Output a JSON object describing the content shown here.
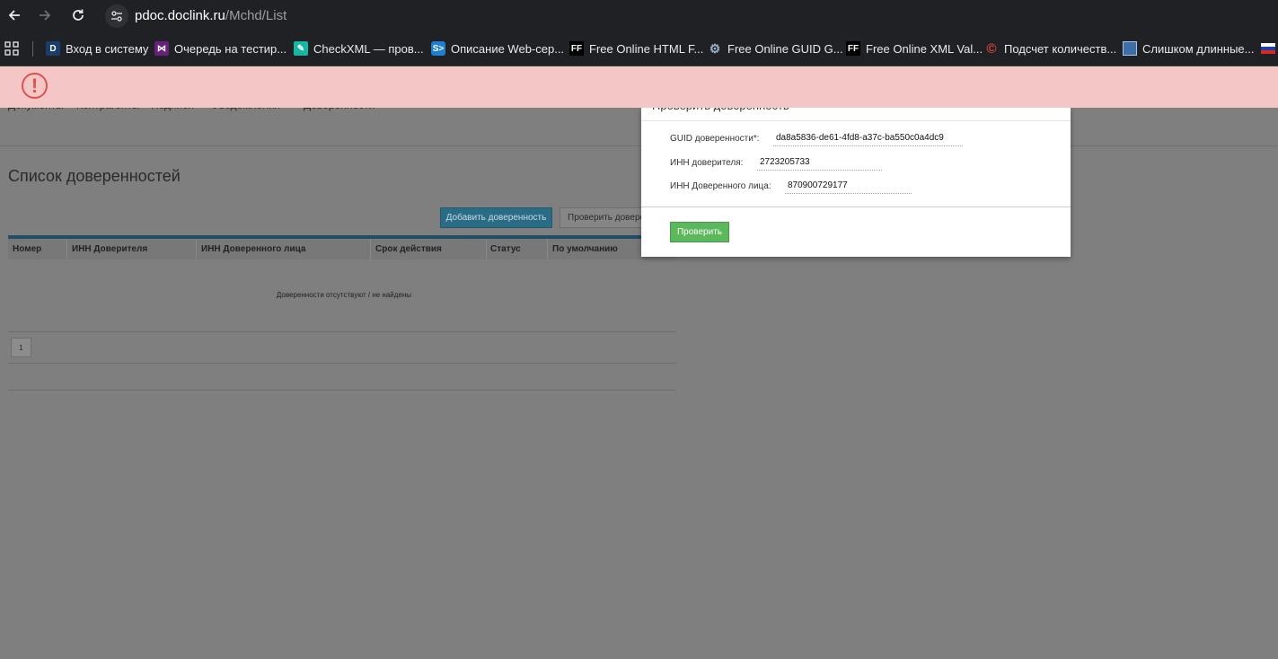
{
  "browser": {
    "url_domain": "pdoc.doclink.ru",
    "url_path": "/Mchd/List",
    "bookmarks": [
      {
        "label": "Вход в систему",
        "icon": "D"
      },
      {
        "label": "Очередь на тестир...",
        "icon": "vs"
      },
      {
        "label": "CheckXML — пров...",
        "icon": "cx"
      },
      {
        "label": "Описание Web-сер...",
        "icon": "S>"
      },
      {
        "label": "Free Online HTML F...",
        "icon": "FF"
      },
      {
        "label": "Free Online GUID G...",
        "icon": "gear"
      },
      {
        "label": "Free Online XML Val...",
        "icon": "FF"
      },
      {
        "label": "Подсчет количеств...",
        "icon": "C"
      },
      {
        "label": "Слишком длинные...",
        "icon": "img"
      }
    ]
  },
  "alert": {
    "icon": "exclamation-circle-icon",
    "symbol": "!"
  },
  "page": {
    "ghost_nav": [
      "Документы",
      "Контрагенты",
      "Подписи",
      "Уведомления",
      "Доверенности"
    ],
    "title": "Список доверенностей",
    "add_button": "Добавить доверенность",
    "check_button": "Проверить доверенность",
    "table": {
      "columns": [
        "Номер",
        "ИНН Доверителя",
        "ИНН Доверенного лица",
        "Срок действия",
        "Статус",
        "По умолчанию"
      ],
      "empty_message": "Доверенности отсутствуют / не найдены"
    },
    "pager": {
      "current_page": "1"
    }
  },
  "modal": {
    "title": "Проверить доверенность",
    "fields": {
      "guid": {
        "label": "GUID доверенности*:",
        "value": "da8a5836-de61-4fd8-a37c-ba550c0a4dc9"
      },
      "inn_principal": {
        "label": "ИНН доверителя:",
        "value": "2723205733"
      },
      "inn_representative": {
        "label": "ИНН Доверенного лица:",
        "value": "870900729177"
      }
    },
    "verify_button": "Проверить"
  },
  "colors": {
    "alert_bg": "#f5c6c6",
    "alert_icon": "#d9534f",
    "primary_button": "#2a6c86",
    "verify_button": "#5cb85c"
  }
}
